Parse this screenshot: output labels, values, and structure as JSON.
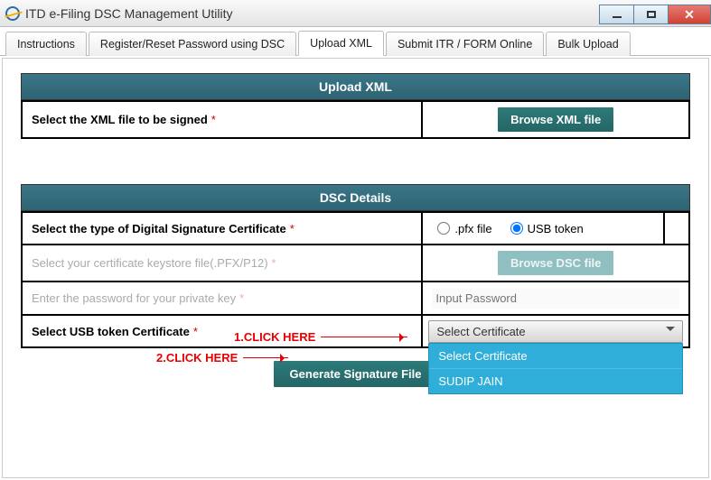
{
  "window": {
    "title": "ITD e-Filing DSC Management Utility"
  },
  "tabs": [
    {
      "label": "Instructions"
    },
    {
      "label": "Register/Reset Password using DSC"
    },
    {
      "label": "Upload XML"
    },
    {
      "label": "Submit ITR / FORM Online"
    },
    {
      "label": "Bulk Upload"
    }
  ],
  "section1": {
    "heading": "Upload XML",
    "row_label": "Select the XML file to be signed",
    "browse_btn": "Browse XML file"
  },
  "section2": {
    "heading": "DSC Details",
    "sig_type_label": "Select the type of Digital Signature Certificate",
    "radio_pfx": ".pfx file",
    "radio_usb": "USB token",
    "keystore_label": "Select your certificate keystore file(.PFX/P12)",
    "browse_dsc_btn": "Browse DSC file",
    "pwd_label": "Enter the password for your private key",
    "pwd_placeholder": "Input Password",
    "usb_cert_label": "Select USB token Certificate",
    "dd_selected": "Select Certificate",
    "dd_options": [
      "Select Certificate",
      "SUDIP JAIN"
    ]
  },
  "generate_btn": "Generate Signature File",
  "annotations": {
    "a1": "1.CLICK HERE",
    "a2": "2.CLICK HERE"
  }
}
